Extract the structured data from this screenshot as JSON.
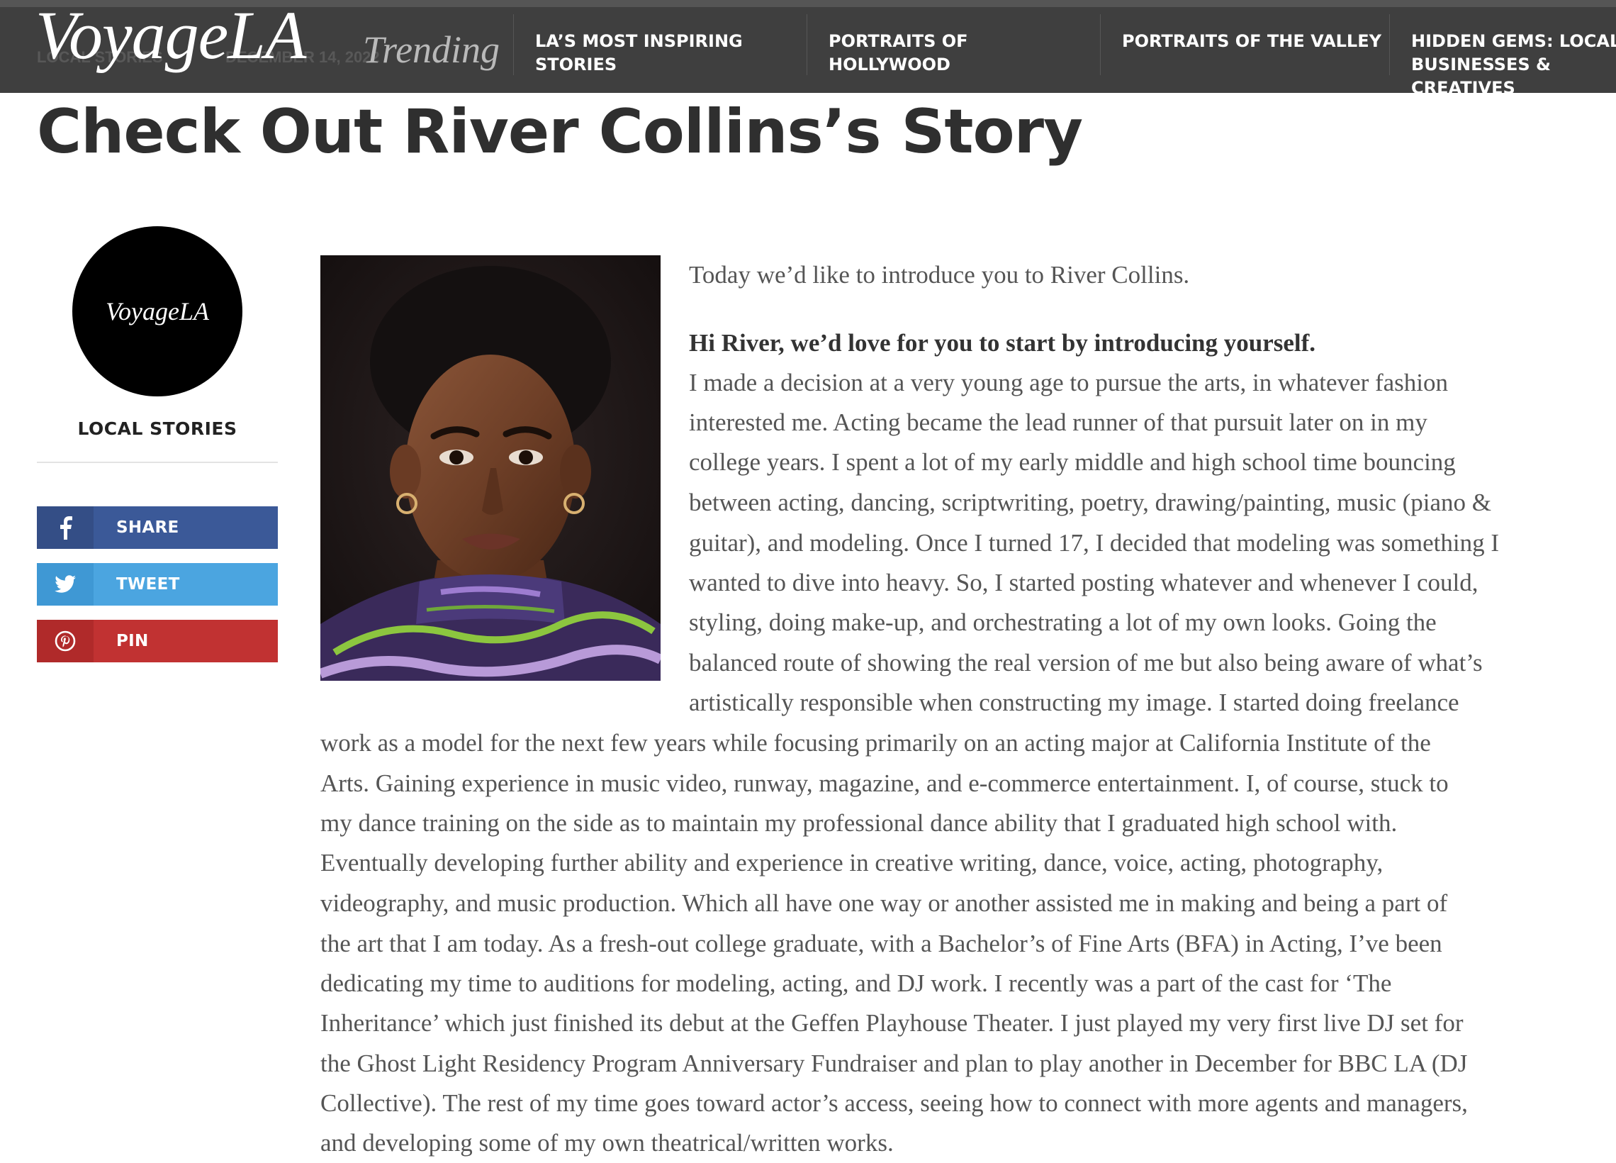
{
  "nav": {
    "logo": "VoyageLA",
    "trending": "Trending",
    "behind_meta_left": "LOCAL STORIES",
    "behind_meta_right": "DECEMBER 14, 2022",
    "items": [
      "LA’S MOST INSPIRING STORIES",
      "PORTRAITS OF HOLLYWOOD",
      "PORTRAITS OF THE VALLEY",
      "HIDDEN GEMS: LOCAL BUSINESSES & CREATIVES"
    ]
  },
  "article": {
    "title": "Check Out River Collins’s Story",
    "intro": "Today we’d like to introduce you to River Collins.",
    "question": "Hi River, we’d love for you to start by introducing yourself.",
    "answer_lines": [
      "I made a decision at a very young age to pursue the arts, in whatever fashion",
      "interested me. Acting became the lead runner of that pursuit later on in my",
      "college years. I spent a lot of my early middle and high school time bouncing",
      "between acting, dancing, scriptwriting, poetry, drawing/painting, music (piano &",
      "guitar), and modeling. Once I turned 17, I decided that modeling was something I",
      "wanted to dive into heavy. So, I started posting whatever and whenever I could,",
      "styling, doing make-up, and orchestrating a lot of my own looks. Going the",
      "balanced route of showing the real version of me but also being aware of what’s",
      "artistically responsible when constructing my image. I started doing freelance",
      "work as a model for the next few years while focusing primarily on an acting major at California Institute of the",
      "Arts. Gaining experience in music video, runway, magazine, and e-commerce entertainment. I, of course, stuck to",
      "my dance training on the side as to maintain my professional dance ability that I graduated high school with.",
      "Eventually developing further ability and experience in creative writing, dance, voice, acting, photography,",
      "videography, and music production. Which all have one way or another assisted me in making and being a part of",
      "the art that I am today. As a fresh-out college graduate, with a Bachelor’s of Fine Arts (BFA) in Acting, I’ve been",
      "dedicating my time to auditions for modeling, acting, and DJ work. I recently was a part of the cast for ‘The",
      "Inheritance’ which just finished its debut at the Geffen Playhouse Theater. I just played my very first live DJ set for",
      "the Ghost Light Residency Program Anniversary Fundraiser and plan to play another in December for BBC LA (DJ",
      "Collective). The rest of my time goes toward actor’s access, seeing how to connect with more agents and managers,",
      "and developing some of my own theatrical/written works."
    ]
  },
  "sidebar": {
    "avatar_text": "VoyageLA",
    "category": "LOCAL STORIES",
    "share_buttons": [
      {
        "label": "SHARE",
        "icon": "facebook-icon",
        "color": "#3b5998"
      },
      {
        "label": "TWEET",
        "icon": "twitter-icon",
        "color": "#4ba5e0"
      },
      {
        "label": "PIN",
        "icon": "pinterest-icon",
        "color": "#c13232"
      }
    ]
  },
  "colors": {
    "nav_bg": "#3f3f3f",
    "title": "#2f2f2f",
    "body_text": "#555555"
  }
}
